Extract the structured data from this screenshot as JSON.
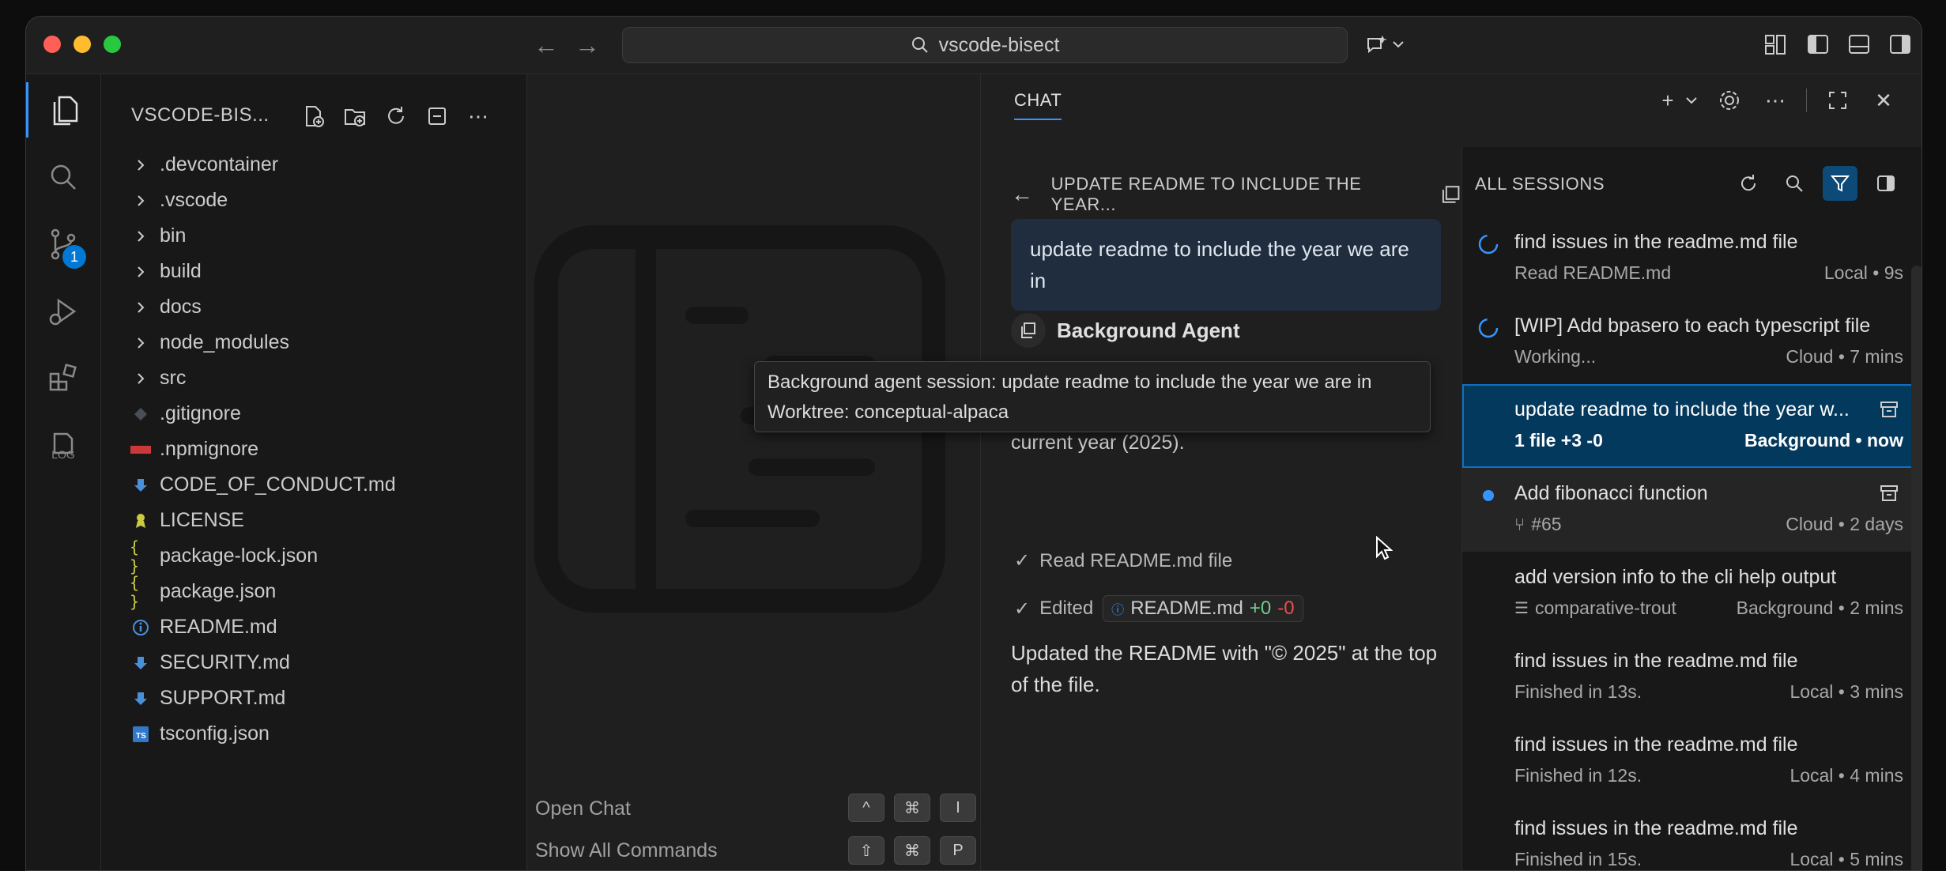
{
  "window": {
    "search_text": "vscode-bisect"
  },
  "activity_bar": {
    "scm_badge": "1",
    "log_label": "LOG"
  },
  "explorer": {
    "title": "VSCODE-BIS...",
    "items": [
      {
        "label": ".devcontainer",
        "icon": "chevron-right-icon"
      },
      {
        "label": ".vscode",
        "icon": "chevron-right-icon"
      },
      {
        "label": "bin",
        "icon": "chevron-right-icon"
      },
      {
        "label": "build",
        "icon": "chevron-right-icon"
      },
      {
        "label": "docs",
        "icon": "chevron-right-icon"
      },
      {
        "label": "node_modules",
        "icon": "chevron-right-icon"
      },
      {
        "label": "src",
        "icon": "chevron-right-icon"
      },
      {
        "label": ".gitignore",
        "icon": "git-icon"
      },
      {
        "label": ".npmignore",
        "icon": "npm-icon"
      },
      {
        "label": "CODE_OF_CONDUCT.md",
        "icon": "markdown-icon"
      },
      {
        "label": "LICENSE",
        "icon": "license-icon"
      },
      {
        "label": "package-lock.json",
        "icon": "json-icon"
      },
      {
        "label": "package.json",
        "icon": "json-icon"
      },
      {
        "label": "README.md",
        "icon": "info-icon"
      },
      {
        "label": "SECURITY.md",
        "icon": "markdown-icon"
      },
      {
        "label": "SUPPORT.md",
        "icon": "markdown-icon"
      },
      {
        "label": "tsconfig.json",
        "icon": "typescript-icon"
      }
    ]
  },
  "editor": {
    "hints": [
      {
        "label": "Open Chat",
        "keys": [
          "^",
          "⌘",
          "I"
        ]
      },
      {
        "label": "Show All Commands",
        "keys": [
          "⇧",
          "⌘",
          "P"
        ]
      }
    ]
  },
  "chat": {
    "tab_label": "CHAT",
    "conversation": {
      "header": "UPDATE README TO INCLUDE THE YEAR...",
      "user_message": "update readme to include the year we are in",
      "agent_name": "Background Agent",
      "partial_text": "current year (2025).",
      "steps": [
        {
          "label": "Read README.md file"
        },
        {
          "label": "Edited",
          "file": "README.md",
          "added": "+0",
          "removed": "-0"
        }
      ],
      "final_text": "Updated the README with \"© 2025\" at the top of the file."
    },
    "sessions": {
      "title": "ALL SESSIONS",
      "items": [
        {
          "title": "find issues in the readme.md file",
          "sub": "Read README.md",
          "meta": "Local • 9s",
          "status": "in-progress"
        },
        {
          "title": "[WIP] Add bpasero to each typescript file",
          "sub": "Working...",
          "meta": "Cloud • 7 mins",
          "status": "in-progress"
        },
        {
          "title": "update readme to include the year w...",
          "sub": "1 file +3 -0",
          "meta": "Background • now",
          "status": "selected"
        },
        {
          "title": "Add fibonacci function",
          "sub": "#65",
          "meta": "Cloud • 2 days",
          "status": "unread"
        },
        {
          "title": "add version info to the cli help output",
          "sub": "comparative-trout",
          "meta": "Background • 2 mins",
          "status": "done"
        },
        {
          "title": "find issues in the readme.md file",
          "sub": "Finished in 13s.",
          "meta": "Local • 3 mins",
          "status": "done"
        },
        {
          "title": "find issues in the readme.md file",
          "sub": "Finished in 12s.",
          "meta": "Local • 4 mins",
          "status": "done"
        },
        {
          "title": "find issues in the readme.md file",
          "sub": "Finished in 15s.",
          "meta": "Local • 5 mins",
          "status": "done"
        }
      ]
    }
  },
  "tooltip": {
    "line1": "Background agent session: update readme to include the year we are in",
    "line2": "Worktree: conceptual-alpaca"
  },
  "colors": {
    "accent": "#0078d4",
    "selection": "#04395e",
    "added": "#73c991",
    "removed": "#f14c4c"
  }
}
